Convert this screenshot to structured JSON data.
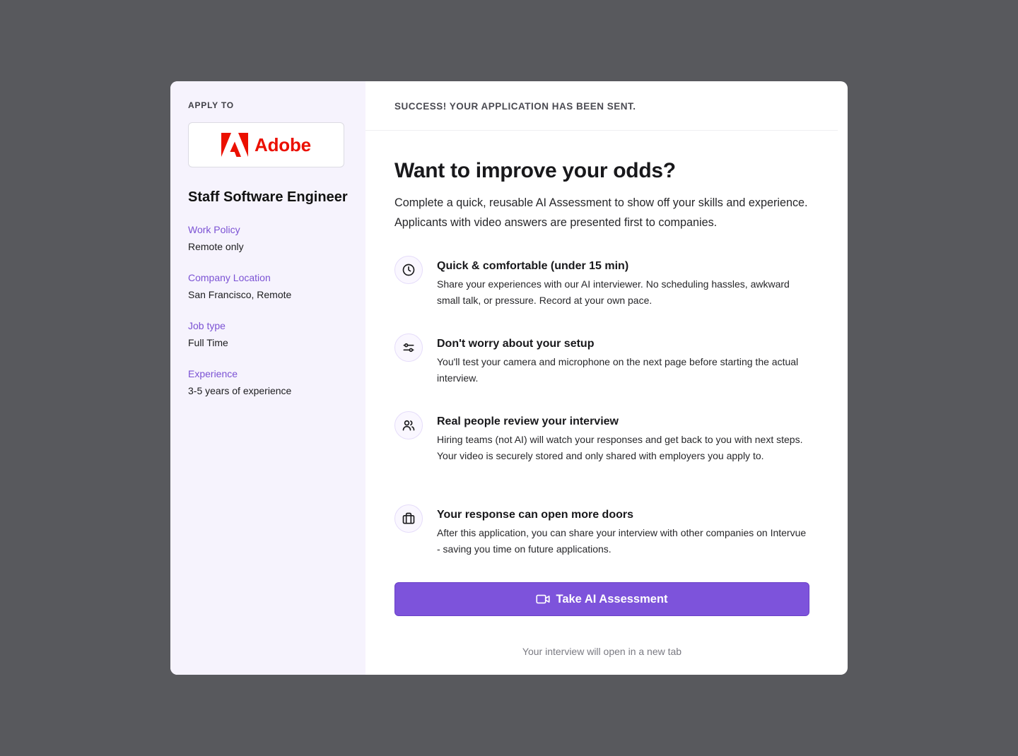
{
  "sidebar": {
    "apply_to": "APPLY TO",
    "company": "Adobe",
    "job_title": "Staff Software Engineer",
    "details": [
      {
        "label": "Work Policy",
        "value": "Remote only"
      },
      {
        "label": "Company Location",
        "value": "San Francisco, Remote"
      },
      {
        "label": "Job type",
        "value": "Full Time"
      },
      {
        "label": "Experience",
        "value": "3-5 years of experience"
      }
    ]
  },
  "main": {
    "success_banner": "SUCCESS! YOUR APPLICATION HAS BEEN SENT.",
    "headline": "Want to improve your odds?",
    "intro": "Complete a quick, reusable AI Assessment to show off your skills and experience. Applicants with video answers are presented first to companies.",
    "features": [
      {
        "icon": "clock-icon",
        "title": "Quick & comfortable (under 15 min)",
        "desc": "Share your experiences with our AI interviewer. No scheduling hassles, awkward small talk, or pressure. Record at your own pace."
      },
      {
        "icon": "sliders-icon",
        "title": "Don't worry about your setup",
        "desc": "You'll test your camera and microphone on the next page before starting the actual interview."
      },
      {
        "icon": "users-icon",
        "title": "Real people review your interview",
        "desc": "Hiring teams (not AI) will watch your responses and get back to you with next steps. Your video is securely stored and only shared with employers you apply to."
      },
      {
        "icon": "briefcase-icon",
        "title": "Your response can open more doors",
        "desc": "After this application, you can share your interview with other companies on Intervue - saving you time on future applications."
      }
    ],
    "cta_label": "Take AI Assessment",
    "cta_icon": "video-camera-icon",
    "note": "Your interview will open in a new tab"
  },
  "colors": {
    "accent": "#7d53db",
    "accent_text": "#7b52d4",
    "sidebar_bg": "#f6f3fd",
    "backdrop": "#58595d",
    "adobe_red": "#eb1000"
  }
}
